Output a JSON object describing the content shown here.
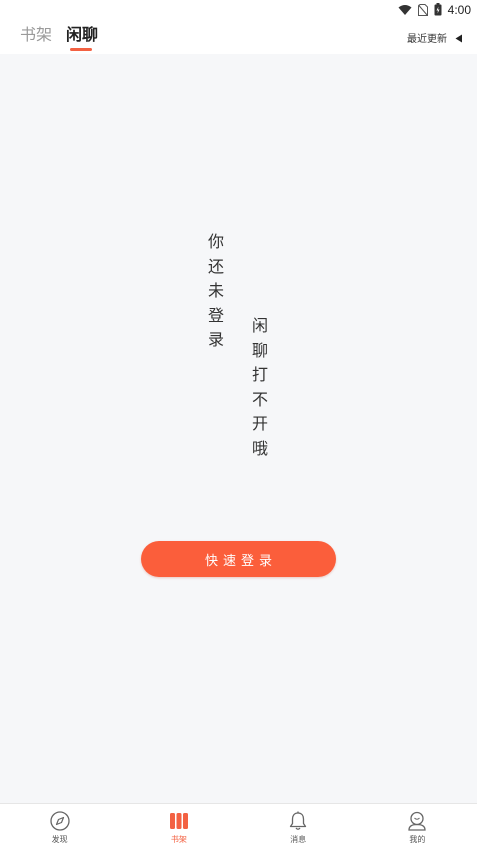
{
  "status_bar": {
    "time": "4:00"
  },
  "header": {
    "tabs": [
      {
        "label": "书架",
        "active": false
      },
      {
        "label": "闲聊",
        "active": true
      }
    ],
    "recent_label": "最近更新"
  },
  "main": {
    "message_col1": [
      "你",
      "还",
      "未",
      "登",
      "录"
    ],
    "message_col2": [
      "闲",
      "聊",
      "打",
      "不",
      "开",
      "哦"
    ],
    "login_button": "快速登录"
  },
  "bottom_nav": {
    "items": [
      {
        "label": "发现",
        "icon": "compass-icon"
      },
      {
        "label": "书架",
        "icon": "bookshelf-icon"
      },
      {
        "label": "消息",
        "icon": "bell-icon"
      },
      {
        "label": "我的",
        "icon": "profile-icon"
      }
    ]
  },
  "colors": {
    "accent": "#f36142",
    "button": "#fb5e3b",
    "background": "#f6f7f9"
  }
}
